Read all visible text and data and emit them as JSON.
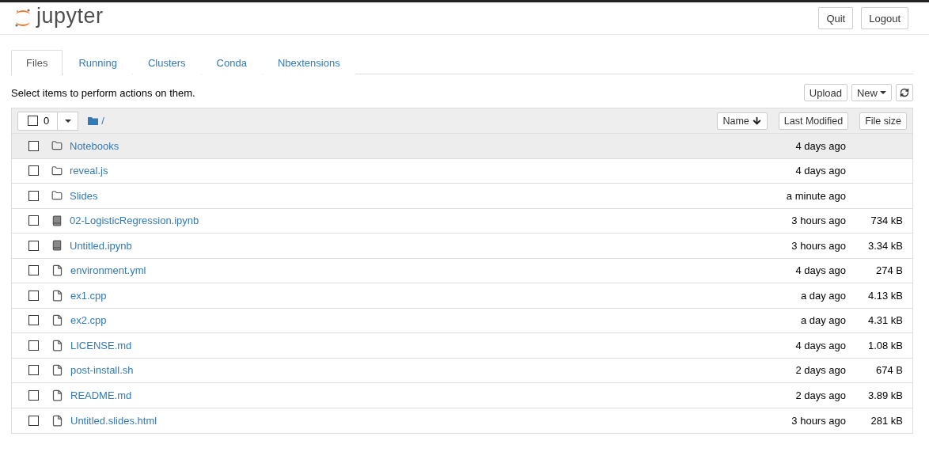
{
  "header": {
    "logo": "jupyter",
    "buttons": [
      "Quit",
      "Logout"
    ]
  },
  "tabs": [
    {
      "label": "Files",
      "selected": true
    },
    {
      "label": "Running",
      "selected": false
    },
    {
      "label": "Clusters",
      "selected": false
    },
    {
      "label": "Conda",
      "selected": false
    },
    {
      "label": "Nbextensions",
      "selected": false
    }
  ],
  "instructions": "Select items to perform actions on them.",
  "actions": {
    "upload": "Upload",
    "new": "New"
  },
  "list_header": {
    "select_all_checked": false,
    "selected_count": "0",
    "path": "/",
    "sort_buttons": [
      "Name",
      "Last Modified",
      "File size"
    ]
  },
  "files": [
    {
      "kind": "folder",
      "name": "Notebooks",
      "modified": "4 days ago",
      "hovered": true,
      "checked": false
    },
    {
      "kind": "folder",
      "name": "reveal.js",
      "modified": "4 days ago",
      "hovered": false,
      "checked": false
    },
    {
      "kind": "folder",
      "name": "Slides",
      "modified": "a minute ago",
      "hovered": false,
      "checked": false
    },
    {
      "kind": "notebook",
      "name": "02-LogisticRegression.ipynb",
      "modified": "3 hours ago",
      "size": "734 kB",
      "hovered": false,
      "checked": false
    },
    {
      "kind": "notebook",
      "name": "Untitled.ipynb",
      "modified": "3 hours ago",
      "size": "3.34 kB",
      "hovered": false,
      "checked": false
    },
    {
      "kind": "file",
      "name": "environment.yml",
      "modified": "4 days ago",
      "size": "274 B",
      "hovered": false,
      "checked": false
    },
    {
      "kind": "file",
      "name": "ex1.cpp",
      "modified": "a day ago",
      "size": "4.13 kB",
      "hovered": false,
      "checked": false
    },
    {
      "kind": "file",
      "name": "ex2.cpp",
      "modified": "a day ago",
      "size": "4.31 kB",
      "hovered": false,
      "checked": false
    },
    {
      "kind": "file",
      "name": "LICENSE.md",
      "modified": "4 days ago",
      "size": "1.08 kB",
      "hovered": false,
      "checked": false
    },
    {
      "kind": "file",
      "name": "post-install.sh",
      "modified": "2 days ago",
      "size": "674 B",
      "hovered": false,
      "checked": false
    },
    {
      "kind": "file",
      "name": "README.md",
      "modified": "2 days ago",
      "size": "3.89 kB",
      "hovered": false,
      "checked": false
    },
    {
      "kind": "file",
      "name": "Untitled.slides.html",
      "modified": "3 hours ago",
      "size": "281 kB",
      "hovered": false,
      "checked": false
    }
  ]
}
